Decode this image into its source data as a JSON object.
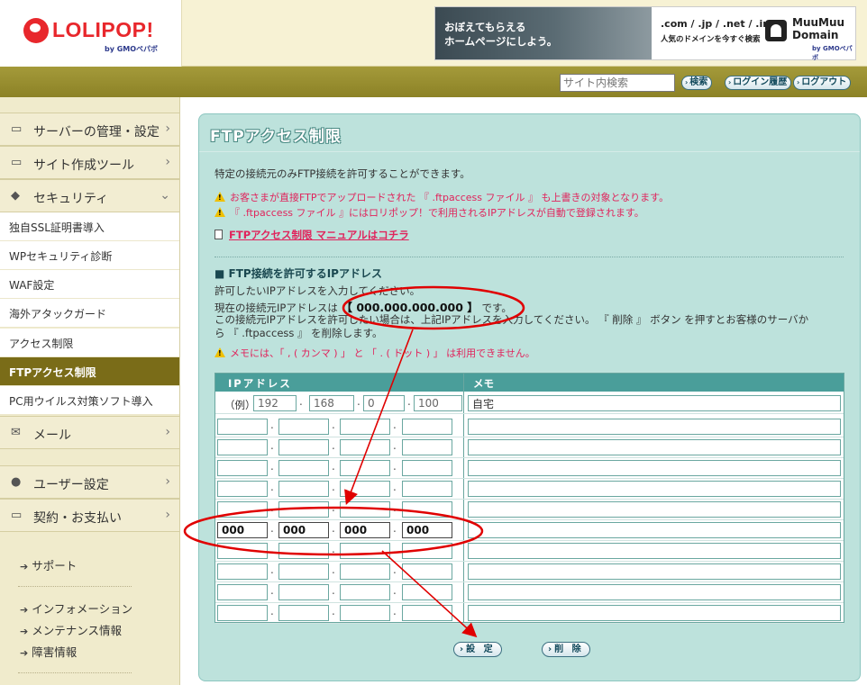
{
  "header": {
    "logo_text": "LOLIPOP!",
    "logo_sub": "by GMOペパボ",
    "ad": {
      "left_text_1": "おぼえてもらえる",
      "left_text_2": "ホームページにしよう。",
      "domains": ".com / .jp / .net / .info",
      "sub": "人気のドメインを今すぐ検索",
      "brand_1": "MuuMuu",
      "brand_2": "Domain",
      "brand_sub": "by GMOペパボ"
    }
  },
  "toolbar": {
    "search_placeholder": "サイト内検索",
    "search_button": "検索",
    "login_history_button": "ログイン履歴",
    "logout_button": "ログアウト"
  },
  "sidebar": {
    "main_items": [
      {
        "label": "サーバーの管理・設定",
        "icon": "server-icon",
        "chev": "›"
      },
      {
        "label": "サイト作成ツール",
        "icon": "laptop-icon",
        "chev": "›"
      },
      {
        "label": "セキュリティ",
        "icon": "shield-icon",
        "chev": "⌄"
      },
      {
        "label": "メール",
        "icon": "mail-icon",
        "chev": "›"
      },
      {
        "label": "ユーザー設定",
        "icon": "user-icon",
        "chev": "›"
      },
      {
        "label": "契約・お支払い",
        "icon": "card-icon",
        "chev": "›"
      }
    ],
    "security_sub_items": [
      "独自SSL証明書導入",
      "WPセキュリティ診断",
      "WAF設定",
      "海外アタックガード",
      "アクセス制限",
      "FTPアクセス制限",
      "PC用ウイルス対策ソフト導入"
    ],
    "active_sub": "FTPアクセス制限",
    "links": [
      "サポート",
      "インフォメーション",
      "メンテナンス情報",
      "障害情報"
    ]
  },
  "main": {
    "title": "FTPアクセス制限",
    "intro": "特定の接続元のみFTP接続を許可することができます。",
    "warnings": [
      "お客さまが直接FTPでアップロードされた 『 .ftpaccess ファイル 』 も上書きの対象となります。",
      "『 .ftpaccess ファイル 』にはロリポップ！で利用されるIPアドレスが自動で登録されます。"
    ],
    "manual_link": "FTPアクセス制限 マニュアルはコチラ",
    "section_title": "■ FTP接続を許可するIPアドレス",
    "line1": "許可したいIPアドレスを入力してください。",
    "line2_prefix": "現在の接続元IPアドレスは",
    "line2_ip": "【 000.000.000.000 】",
    "line2_suffix": "です。",
    "line3": "この接続元IPアドレスを許可したい場合は、上記IPアドレスを入力してください。 『 削除 』 ボタン を押すとお客様のサーバか",
    "line4": "ら 『 .ftpaccess 』 を削除します。",
    "memo_warning": "メモには、「 , ( カンマ ) 」 と 「 . ( ドット ) 」 は利用できません。",
    "table": {
      "col_ip": "IPアドレス",
      "col_memo": "メモ",
      "example_label": "（例）",
      "example_ip": [
        "192",
        "168",
        "0",
        "100"
      ],
      "example_memo": "自宅",
      "new_row_ip": [
        "000",
        "000",
        "000",
        "000"
      ]
    },
    "set_button": "設 定",
    "delete_button": "削 除"
  },
  "colors": {
    "brand_red": "#e8272c",
    "olive": "#8c8226",
    "panel_bg": "#bde2dc",
    "table_head": "#4a9e9a",
    "warning_pink": "#e0245c",
    "annotation_red": "#e00000"
  }
}
